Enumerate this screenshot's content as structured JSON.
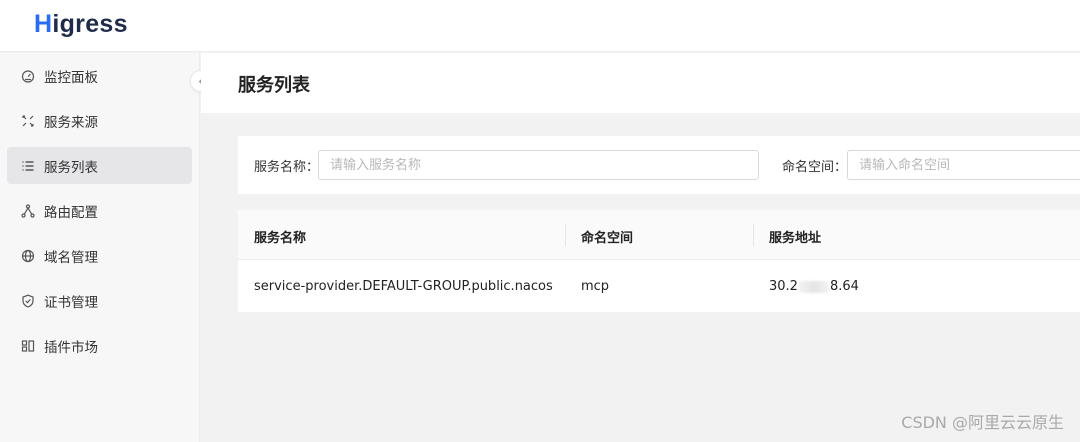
{
  "header": {
    "logo_initial": "H",
    "logo_rest": "igress"
  },
  "sidebar": {
    "items": [
      {
        "label": "监控面板",
        "icon": "dashboard-icon",
        "active": false
      },
      {
        "label": "服务来源",
        "icon": "source-icon",
        "active": false
      },
      {
        "label": "服务列表",
        "icon": "list-icon",
        "active": true
      },
      {
        "label": "路由配置",
        "icon": "route-icon",
        "active": false
      },
      {
        "label": "域名管理",
        "icon": "globe-icon",
        "active": false
      },
      {
        "label": "证书管理",
        "icon": "shield-icon",
        "active": false
      },
      {
        "label": "插件市场",
        "icon": "plugin-icon",
        "active": false
      }
    ],
    "collapse_icon": "chevron-left-icon"
  },
  "page": {
    "title": "服务列表"
  },
  "filters": {
    "service_name": {
      "label": "服务名称：",
      "placeholder": "请输入服务名称",
      "value": ""
    },
    "namespace": {
      "label": "命名空间：",
      "placeholder": "请输入命名空间",
      "value": ""
    }
  },
  "table": {
    "columns": [
      "服务名称",
      "命名空间",
      "服务地址"
    ],
    "rows": [
      {
        "service_name": "service-provider.DEFAULT-GROUP.public.nacos",
        "namespace": "mcp",
        "address_start": "30.2",
        "address_end": "8.64"
      }
    ]
  },
  "watermark": "CSDN @阿里云云原生",
  "colors": {
    "accent": "#2a6df4",
    "logo": "#1e2b4a",
    "active_bg": "#e6e6e8"
  }
}
